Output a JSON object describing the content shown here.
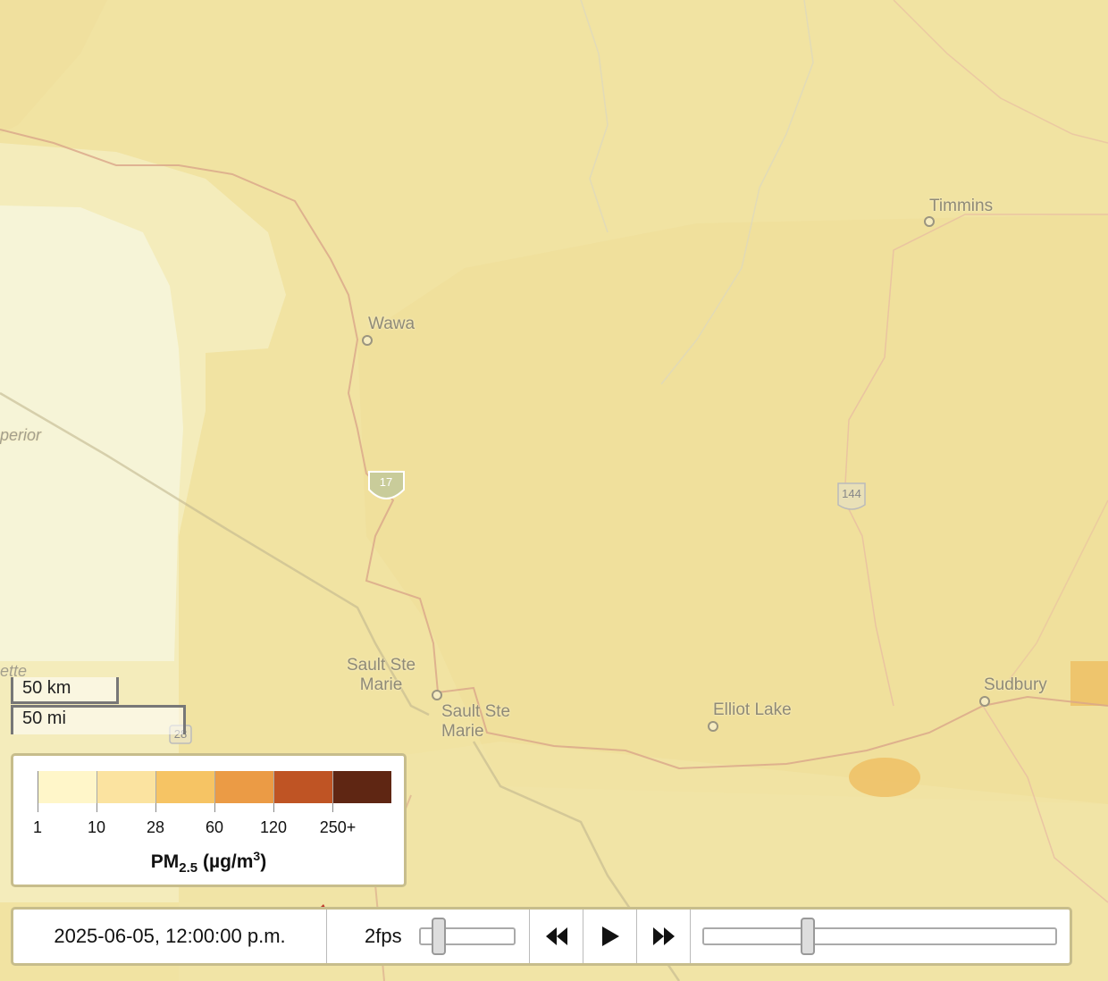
{
  "map": {
    "cities": [
      {
        "name": "Timmins",
        "id": "timmins"
      },
      {
        "name": "Wawa",
        "id": "wawa"
      },
      {
        "name": "Sault Ste\nMarie",
        "id": "sault-ste-marie-on"
      },
      {
        "name": "Sault Ste\nMarie",
        "id": "sault-ste-marie-mi"
      },
      {
        "name": "Elliot Lake",
        "id": "elliot-lake"
      },
      {
        "name": "Sudbury",
        "id": "sudbury"
      }
    ],
    "water_labels": [
      {
        "name": "perior",
        "id": "lake-superior"
      },
      {
        "name": "ette",
        "id": "marquette"
      }
    ],
    "road_shields": [
      {
        "label": "17",
        "id": "hwy-17"
      },
      {
        "label": "144",
        "id": "hwy-144"
      },
      {
        "label": "28",
        "id": "hwy-28"
      }
    ],
    "colors": {
      "land_base": "#f1e3a2",
      "pm_low": "#fdf3c4",
      "pm_mid": "#f0c45c",
      "boundary": "#d9a58a"
    }
  },
  "scale_bar": {
    "km_label": "50 km",
    "mi_label": "50 mi"
  },
  "legend": {
    "swatch_colors": [
      "#fff6c9",
      "#fbe3a0",
      "#f6c464",
      "#eb9b45",
      "#bf5424",
      "#5f2613"
    ],
    "labels": [
      "1",
      "10",
      "28",
      "60",
      "120",
      "250+"
    ],
    "title_main": "PM",
    "title_sub": "2.5",
    "title_units": " (µg/m",
    "title_sup": "3",
    "title_close": ")"
  },
  "player": {
    "timestamp": "2025-06-05, 12:00:00 p.m.",
    "fps_label": "2fps",
    "fps_position": 0.15,
    "timeline_position": 0.29,
    "buttons": {
      "rewind": "rewind-icon",
      "play": "play-icon",
      "fast_forward": "fast-forward-icon"
    }
  }
}
